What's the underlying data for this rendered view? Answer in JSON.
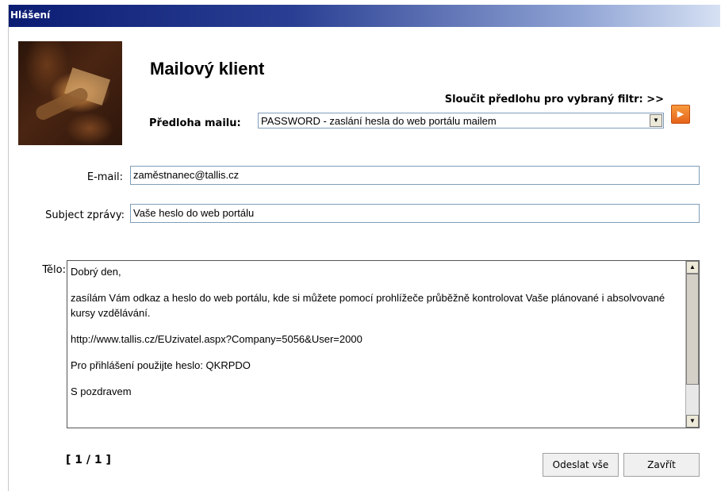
{
  "window": {
    "title": "Hlášení"
  },
  "header": {
    "app_title": "Mailový klient",
    "merge_label": "Sloučit předlohu pro vybraný filtr: >>"
  },
  "template": {
    "label": "Předloha mailu:",
    "selected": "PASSWORD - zaslání hesla do web portálu mailem"
  },
  "form": {
    "email_label": "E-mail:",
    "email_value": "zaměstnanec@tallis.cz",
    "subject_label": "Subject zprávy:",
    "subject_value": "Vaše heslo do web portálu",
    "body_label": "Tělo:",
    "body_lines": [
      "Dobrý den,",
      "zasílám Vám odkaz a heslo do web portálu, kde si můžete pomocí prohlížeče průběžně kontrolovat  Vaše plánované i absolvované kursy vzdělávání.",
      "http://www.tallis.cz/EUzivatel.aspx?Company=5056&User=2000",
      "Pro přihlášení použijte heslo:  QKRPDO",
      "S pozdravem"
    ]
  },
  "footer": {
    "pager": "[ 1 / 1 ]",
    "send_all_label": "Odeslat vše",
    "close_label": "Zavřít"
  },
  "colors": {
    "titlebar_start": "#0b1d73",
    "titlebar_end": "#d6e1f3",
    "go_button": "#e5631a",
    "input_border": "#7f9db9"
  },
  "icons": {
    "select_arrow": "chevron-down-icon",
    "go_button": "play-arrow-icon",
    "scroll_up": "chevron-up-icon",
    "scroll_down": "chevron-down-icon"
  }
}
